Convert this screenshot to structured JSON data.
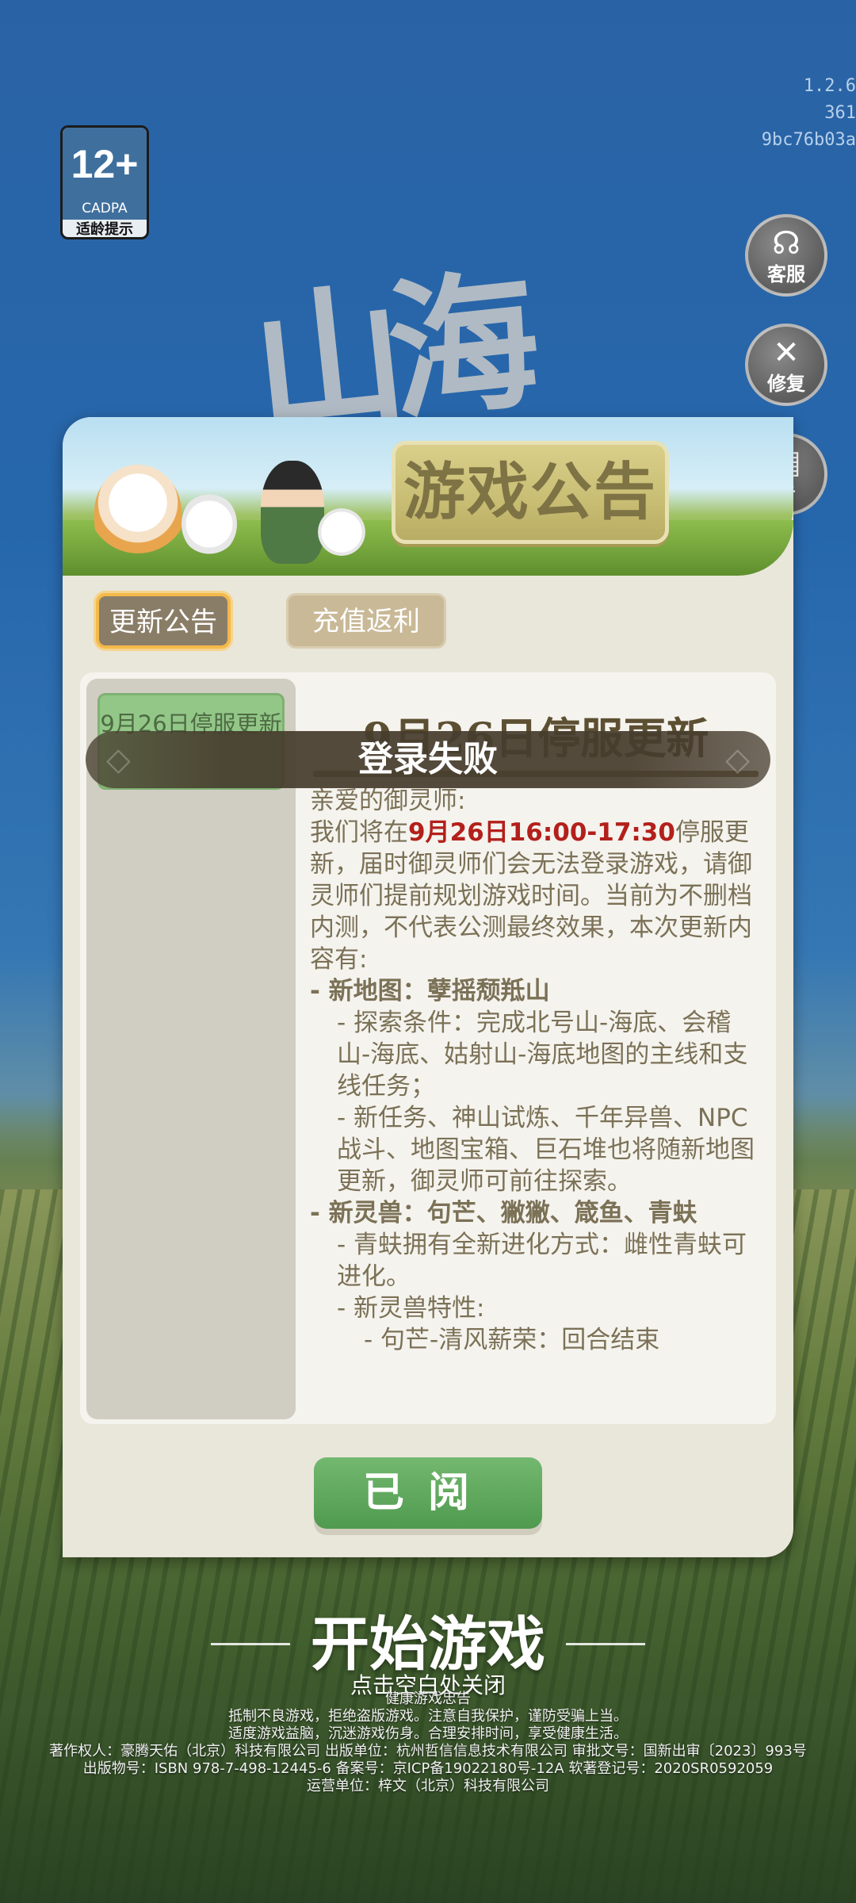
{
  "version": {
    "line1": "1.2.6",
    "line2": "361",
    "line3": "9bc76b03a"
  },
  "age_rating": {
    "age": "12+",
    "org": "CADPA",
    "hint": "适龄提示"
  },
  "side_buttons": [
    {
      "label": "客服",
      "icon": "headset-icon"
    },
    {
      "label": "修复",
      "icon": "wrench-icon"
    },
    {
      "label": "告",
      "icon": "notice-icon"
    }
  ],
  "notice": {
    "title": "游戏公告",
    "tabs": [
      {
        "label": "更新公告",
        "active": true
      },
      {
        "label": "充值返利",
        "active": false
      }
    ],
    "list_items": [
      {
        "label": "9月26日停服更新"
      }
    ],
    "article": {
      "title": "9月26日停服更新",
      "greeting": "亲爱的御灵师:",
      "p1_before": "我们将在",
      "p1_highlight": "9月26日16:00-17:30",
      "p1_after": "停服更新，届时御灵师们会无法登录游戏，请御灵师们提前规划游戏时间。当前为不删档内测，不代表公测最终效果，本次更新内容有:",
      "h1": "- 新地图：孽摇颓羝山",
      "h1_a": "- 探索条件：完成北号山-海底、会稽山-海底、姑射山-海底地图的主线和支线任务；",
      "h1_b": "- 新任务、神山试炼、千年异兽、NPC战斗、地图宝箱、巨石堆也将随新地图更新，御灵师可前往探索。",
      "h2": "- 新灵兽：句芒、獙獙、箴鱼、青蚨",
      "h2_a": "- 青蚨拥有全新进化方式：雌性青蚨可进化。",
      "h2_b": "- 新灵兽特性:",
      "h2_c": "- 句芒-清风薪荣：回合结束"
    },
    "read_button": "已阅"
  },
  "toast": "登录失败",
  "start_game": "开始游戏",
  "close_hint": "点击空白处关闭",
  "footer": {
    "line1": "健康游戏忠告",
    "line2": "抵制不良游戏，拒绝盗版游戏。注意自我保护，谨防受骗上当。",
    "line3": "适度游戏益脑，沉迷游戏伤身。合理安排时间，享受健康生活。",
    "line4": "著作权人：豪腾天佑（北京）科技有限公司  出版单位：杭州哲信信息技术有限公司  审批文号：国新出审〔2023〕993号",
    "line5": "出版物号：ISBN 978-7-498-12445-6  备案号：京ICP备19022180号-12A  软著登记号：2020SR0592059",
    "line6": "运营单位：梓文（北京）科技有限公司"
  }
}
